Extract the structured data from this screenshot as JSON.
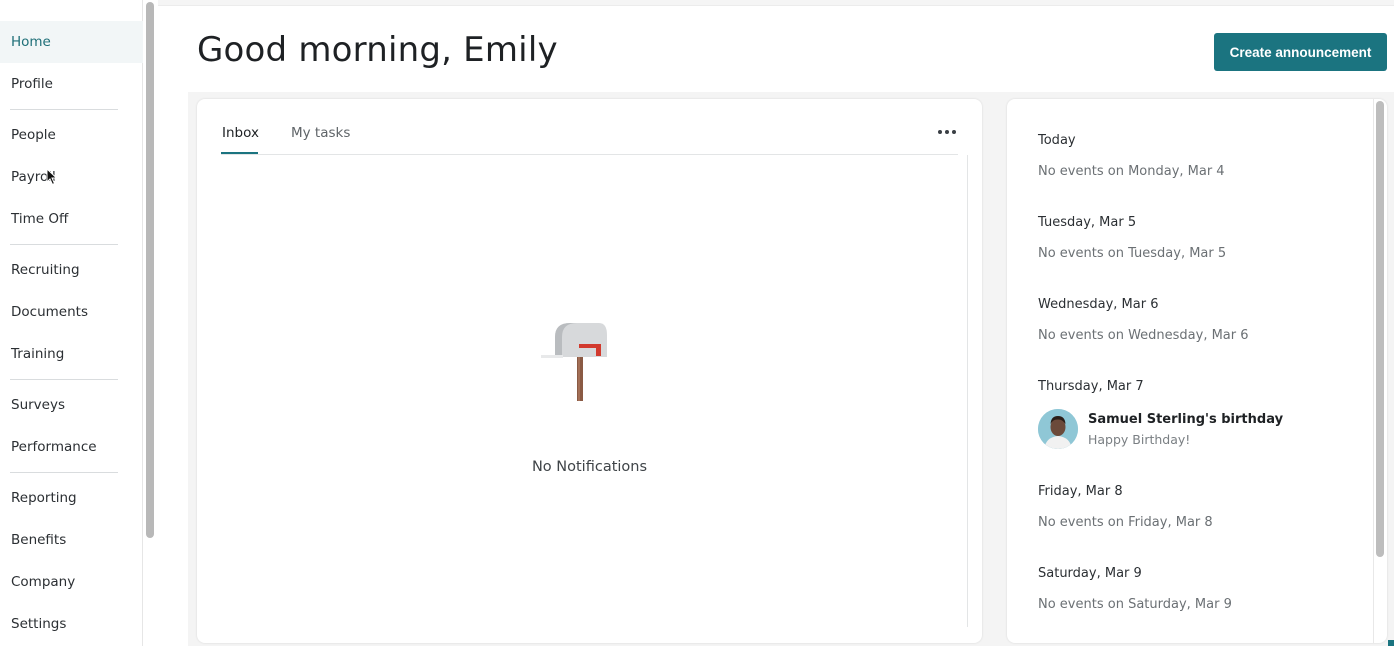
{
  "sidebar": {
    "items": [
      {
        "label": "Home",
        "active": true
      },
      {
        "label": "Profile"
      },
      {
        "label": "People"
      },
      {
        "label": "Payroll"
      },
      {
        "label": "Time Off"
      },
      {
        "label": "Recruiting"
      },
      {
        "label": "Documents"
      },
      {
        "label": "Training"
      },
      {
        "label": "Surveys"
      },
      {
        "label": "Performance"
      },
      {
        "label": "Reporting"
      },
      {
        "label": "Benefits"
      },
      {
        "label": "Company"
      },
      {
        "label": "Settings"
      }
    ]
  },
  "header": {
    "greeting": "Good morning, Emily",
    "create_label": "Create announcement"
  },
  "inbox": {
    "tabs": [
      "Inbox",
      "My tasks"
    ],
    "active_tab": "Inbox",
    "empty_icon": "mailbox-icon",
    "empty_text": "No Notifications"
  },
  "events": [
    {
      "day": "Today",
      "text": "No events on Monday, Mar 4"
    },
    {
      "day": "Tuesday, Mar 5",
      "text": "No events on Tuesday, Mar 5"
    },
    {
      "day": "Wednesday, Mar 6",
      "text": "No events on Wednesday, Mar 6"
    },
    {
      "day": "Thursday, Mar 7",
      "event": {
        "title": "Samuel Sterling's birthday",
        "subtitle": "Happy Birthday!"
      }
    },
    {
      "day": "Friday, Mar 8",
      "text": "No events on Friday, Mar 8"
    },
    {
      "day": "Saturday, Mar 9",
      "text": "No events on Saturday, Mar 9"
    }
  ],
  "colors": {
    "accent": "#1b7480",
    "active_nav_bg": "#f2f6f7"
  }
}
